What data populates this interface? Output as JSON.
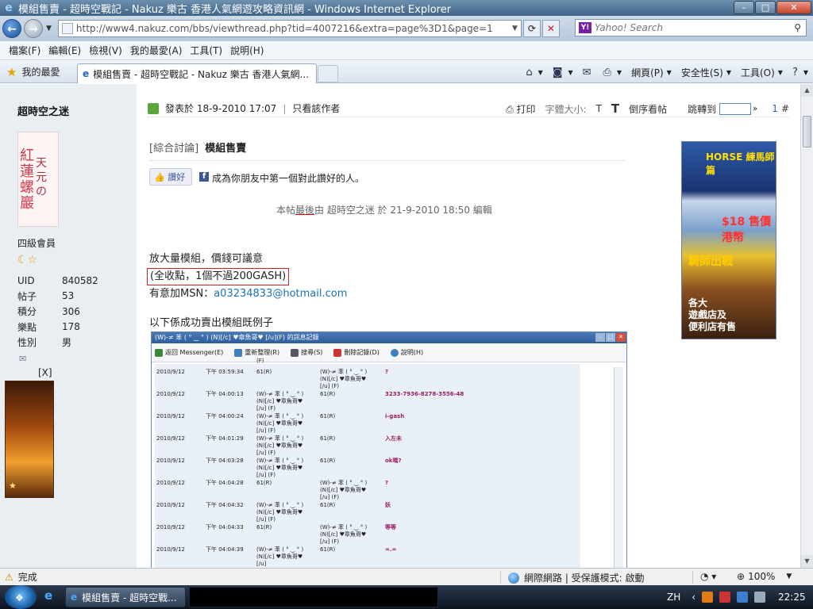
{
  "window": {
    "title": "模組售賣 - 超時空戰記 - Nakuz 樂古 香港人氣網遊攻略資訊網 - Windows Internet Explorer",
    "min": "–",
    "max": "□",
    "close": "✕"
  },
  "address": {
    "url": "http://www4.nakuz.com/bbs/viewthread.php?tid=4007216&extra=page%3D1&page=1",
    "search_placeholder": "Yahoo! Search"
  },
  "menu": [
    "檔案(F)",
    "編輯(E)",
    "檢視(V)",
    "我的最愛(A)",
    "工具(T)",
    "說明(H)"
  ],
  "favbar": {
    "favorites": "我的最愛",
    "tab_title": "模組售賣 - 超時空戰記 - Nakuz 樂古 香港人氣網...",
    "cmds": [
      "網頁(P)",
      "安全性(S)",
      "工具(O)"
    ]
  },
  "user": {
    "name": "超時空之迷",
    "avatar_text1": "紅蓮螺巖",
    "avatar_text2": "天元の",
    "level": "四級會員",
    "stats": [
      {
        "k": "UID",
        "v": "840582"
      },
      {
        "k": "帖子",
        "v": "53"
      },
      {
        "k": "積分",
        "v": "306"
      },
      {
        "k": "樂點",
        "v": "178"
      },
      {
        "k": "性別",
        "v": "男"
      }
    ],
    "ad_close": "[X]"
  },
  "post": {
    "posted_at": "發表於 18-9-2010 17:07",
    "only_author": "只看該作者",
    "print": "打印",
    "font_size": "字體大小:",
    "font_t": "T",
    "reverse": "倒序看帖",
    "jump": "跳轉到",
    "page_num": "1",
    "floor": "#",
    "category": "[綜合討論]",
    "title": "模組售賣",
    "like_btn": "讚好",
    "like_text": "成為你朋友中第一個對此讚好的人。",
    "edit_note_pre": "本帖",
    "edit_note_u": "最後",
    "edit_note_post": "由 超時空之迷 於 21-9-2010 18:50 編輯",
    "line1": "放大量模組，價錢可議意",
    "line2": "(全收點，1個不過200GASH)",
    "line3_prefix": "有意加MSN：",
    "msn": "a03234833@hotmail.com",
    "example": "以下係成功賣出模組既例子"
  },
  "screenshot": {
    "title": "(W)-≠ 苯 ( ° ‿ ° ) (N)[/c] ♥章魚哥♥ [/u](F) 的訊息記錄",
    "tools": [
      "返回 Messenger(E)",
      "重新整理(R)",
      "搜尋(S)",
      "刪除記錄(D)",
      "說明(H)"
    ],
    "rows": [
      {
        "date": "",
        "time": "",
        "from": "(F)",
        "to": "",
        "msg": ""
      },
      {
        "date": "2010/9/12",
        "time": "下午 03:59:34",
        "from": "61(R)",
        "to": "(W)-≠ 苯 ( ° ‿ ° ) (N)[/c] ♥章魚哥♥ [/u] (F)",
        "msg": "?"
      },
      {
        "date": "2010/9/12",
        "time": "下午 04:00:13",
        "from": "(W)-≠ 苯 ( ° ‿ ° ) (N)[/c] ♥章魚哥♥ [/u] (F)",
        "to": "61(R)",
        "msg": "3233-7936-8278-3556-48"
      },
      {
        "date": "2010/9/12",
        "time": "下午 04:00:24",
        "from": "(W)-≠ 苯 ( ° ‿ ° ) (N)[/c] ♥章魚哥♥ [/u] (F)",
        "to": "61(R)",
        "msg": "i-gash"
      },
      {
        "date": "2010/9/12",
        "time": "下午 04:01:29",
        "from": "(W)-≠ 苯 ( ° ‿ ° ) (N)[/c] ♥章魚哥♥ [/u] (F)",
        "to": "61(R)",
        "msg": "入左未"
      },
      {
        "date": "2010/9/12",
        "time": "下午 04:03:28",
        "from": "(W)-≠ 苯 ( ° ‿ ° ) (N)[/c] ♥章魚哥♥ [/u] (F)",
        "to": "61(R)",
        "msg": "ok嗎?"
      },
      {
        "date": "2010/9/12",
        "time": "下午 04:04:28",
        "from": "61(R)",
        "to": "(W)-≠ 苯 ( ° ‿ ° ) (N)[/c] ♥章魚哥♥ [/u] (F)",
        "msg": "?"
      },
      {
        "date": "2010/9/12",
        "time": "下午 04:04:32",
        "from": "(W)-≠ 苯 ( ° ‿ ° ) (N)[/c] ♥章魚哥♥ [/u] (F)",
        "to": "61(R)",
        "msg": "妖"
      },
      {
        "date": "2010/9/12",
        "time": "下午 04:04:33",
        "from": "61(R)",
        "to": "(W)-≠ 苯 ( ° ‿ ° ) (N)[/c] ♥章魚哥♥ [/u] (F)",
        "msg": "等等"
      },
      {
        "date": "2010/9/12",
        "time": "下午 04:04:39",
        "from": "(W)-≠ 苯 ( ° ‿ ° ) (N)[/c] ♥章魚哥♥ [/u]",
        "to": "61(R)",
        "msg": "=.="
      }
    ]
  },
  "right_ad": {
    "r1": "HORSE 練馬師篇",
    "r2": "$18 售價港幣",
    "r3": "騎師出戰",
    "r4": "各大\n遊戲店及\n便利店有售"
  },
  "status": {
    "text": "完成",
    "zone": "網際網路 | 受保護模式: 啟動",
    "zoom": "100%"
  },
  "taskbar": {
    "item": "模組售賣 - 超時空戰...",
    "lang": "ZH",
    "clock": "22:25"
  }
}
